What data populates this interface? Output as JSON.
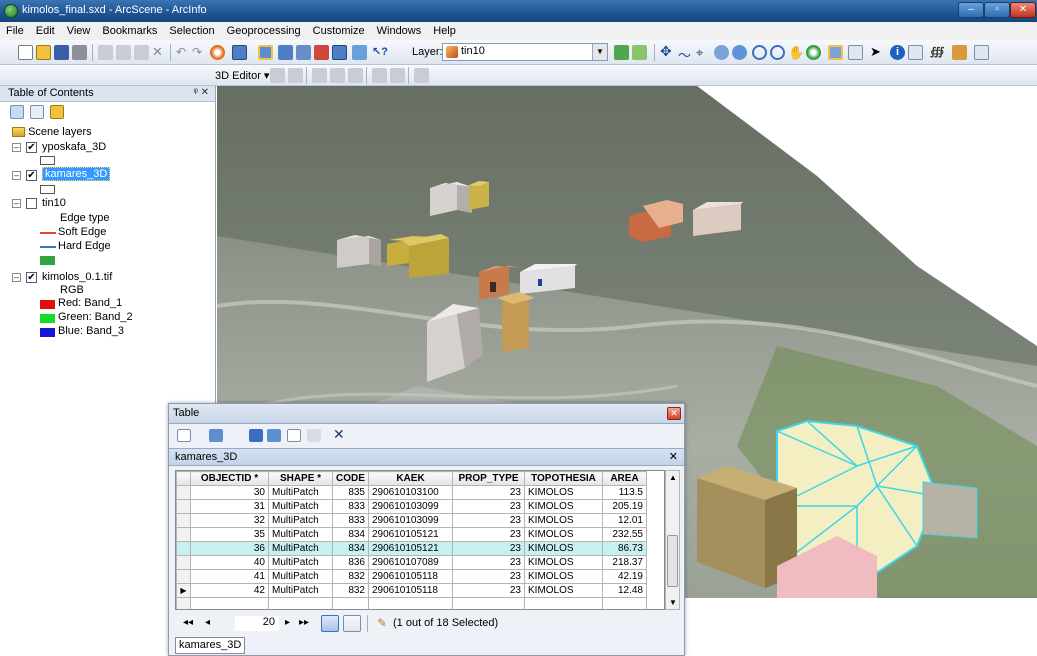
{
  "window": {
    "title": "kimolos_final.sxd - ArcScene - ArcInfo"
  },
  "menu": [
    "File",
    "Edit",
    "View",
    "Bookmarks",
    "Selection",
    "Geoprocessing",
    "Customize",
    "Windows",
    "Help"
  ],
  "toolbar": {
    "layer_label": "Layer:",
    "layer_value": "tin10",
    "editor_label": "3D Editor ▾"
  },
  "toc": {
    "title": "Table of Contents",
    "pin_close": "ᵠ ✕",
    "root": "Scene layers",
    "layers": {
      "yposkafa": {
        "name": "yposkafa_3D"
      },
      "kamares": {
        "name": "kamares_3D"
      },
      "tin10": {
        "name": "tin10",
        "edge_heading": "Edge type",
        "soft_edge": "Soft Edge",
        "hard_edge": "Hard Edge"
      },
      "kimolos": {
        "name": "kimolos_0.1.tif",
        "rgb": "RGB",
        "red": "Red:   Band_1",
        "green": "Green: Band_2",
        "blue": "Blue:  Band_3"
      }
    },
    "colors": {
      "soft_edge": "#e0443a",
      "hard_edge": "#3d6ed6",
      "tin_fill": "#2fa63d",
      "red": "#e01010",
      "green": "#16d92a",
      "blue": "#1515d8"
    }
  },
  "table": {
    "window_title": "Table",
    "tab_title": "kamares_3D",
    "columns": [
      "OBJECTID *",
      "SHAPE *",
      "CODE",
      "KAEK",
      "PROP_TYPE",
      "TOPOTHESIA",
      "AREA"
    ],
    "rows": [
      [
        "30",
        "MultiPatch",
        "835",
        "290610103100",
        "23",
        "KIMOLOS",
        "113.5"
      ],
      [
        "31",
        "MultiPatch",
        "833",
        "290610103099",
        "23",
        "KIMOLOS",
        "205.19"
      ],
      [
        "32",
        "MultiPatch",
        "833",
        "290610103099",
        "23",
        "KIMOLOS",
        "12.01"
      ],
      [
        "35",
        "MultiPatch",
        "834",
        "290610105121",
        "23",
        "KIMOLOS",
        "232.55"
      ],
      [
        "36",
        "MultiPatch",
        "834",
        "290610105121",
        "23",
        "KIMOLOS",
        "86.73"
      ],
      [
        "40",
        "MultiPatch",
        "836",
        "290610107089",
        "23",
        "KIMOLOS",
        "218.37"
      ],
      [
        "41",
        "MultiPatch",
        "832",
        "290610105118",
        "23",
        "KIMOLOS",
        "42.19"
      ],
      [
        "42",
        "MultiPatch",
        "832",
        "290610105118",
        "23",
        "KIMOLOS",
        "12.48"
      ]
    ],
    "highlighted_row": 4,
    "current_row": 7,
    "nav": {
      "first": "◂◂",
      "prev": "◂",
      "record": "20",
      "next": "▸",
      "last": "▸▸",
      "status": "(1 out of 18 Selected)"
    },
    "bottom_tab": "kamares_3D",
    "highlight_color": "#c7f0f0"
  }
}
